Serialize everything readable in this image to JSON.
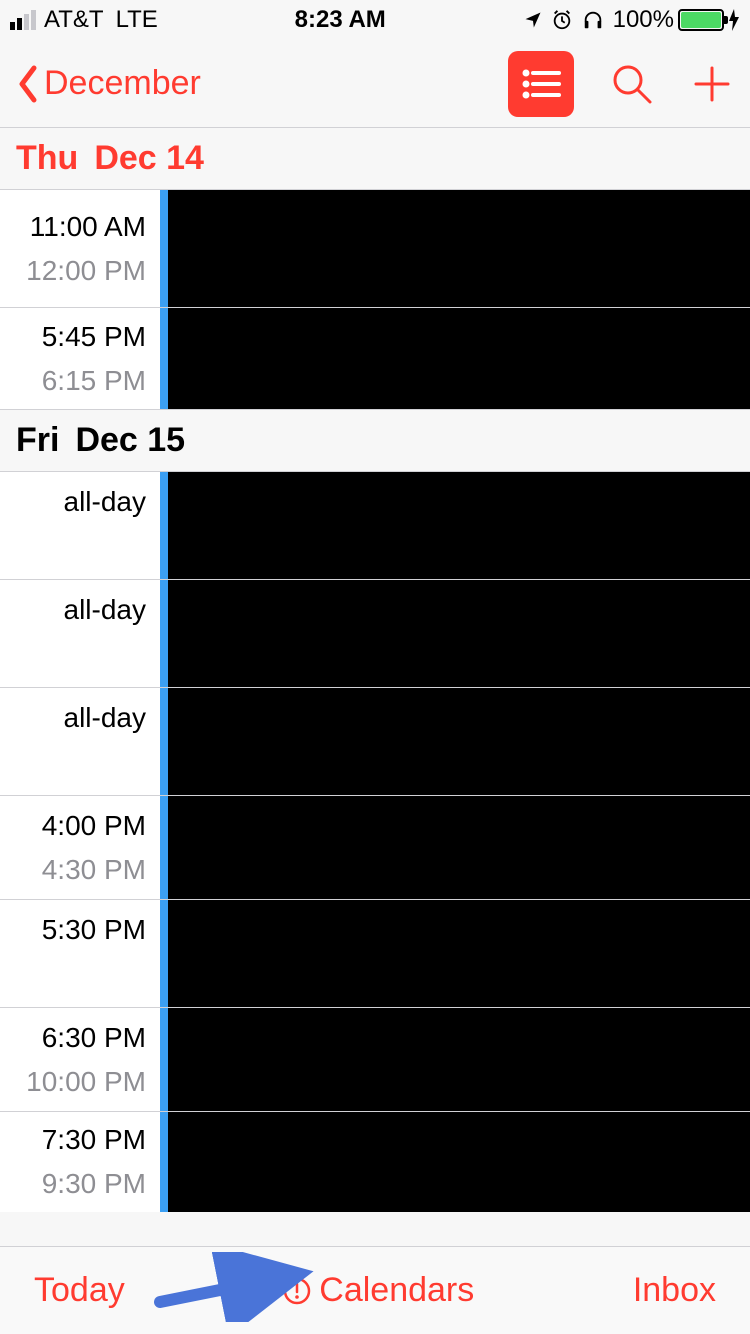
{
  "status_bar": {
    "carrier": "AT&T",
    "network": "LTE",
    "time": "8:23 AM",
    "battery_pct": "100%"
  },
  "nav": {
    "back_label": "December"
  },
  "days": [
    {
      "dow": "Thu",
      "date": "Dec 14",
      "is_current": true,
      "events": [
        {
          "start": "11:00 AM",
          "end": "12:00 PM"
        },
        {
          "start": "5:45 PM",
          "end": "6:15 PM"
        }
      ]
    },
    {
      "dow": "Fri",
      "date": "Dec 15",
      "is_current": false,
      "events": [
        {
          "start": "all-day",
          "end": ""
        },
        {
          "start": "all-day",
          "end": ""
        },
        {
          "start": "all-day",
          "end": ""
        },
        {
          "start": "4:00 PM",
          "end": "4:30 PM"
        },
        {
          "start": "5:30 PM",
          "end": ""
        },
        {
          "start": "6:30 PM",
          "end": "10:00 PM"
        },
        {
          "start": "7:30 PM",
          "end": "9:30 PM"
        }
      ]
    }
  ],
  "toolbar": {
    "today": "Today",
    "calendars": "Calendars",
    "inbox": "Inbox"
  }
}
